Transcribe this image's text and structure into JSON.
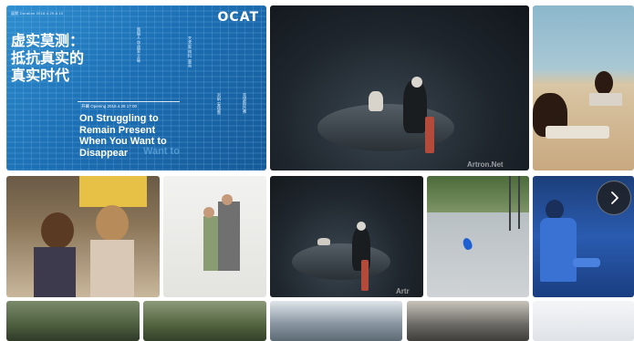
{
  "poster": {
    "logo": "OCAT",
    "dates_label": "展期 Duration  2018.4.29-6.10",
    "title_cn_line1": "虚实莫测：",
    "title_cn_line2": "抵抗真实的",
    "title_cn_line3": "真实时代",
    "opening_label": "开幕 Opening  2018.4.28  17:00",
    "title_en_line1": "On Struggling to",
    "title_en_line2": "Remain Present",
    "title_en_line3": "When You Want to",
    "title_en_line4": "Disappear",
    "ghost_text": "Want to",
    "vertical_text_1": "策展人 华迪爱 王咏",
    "vertical_text_2": "艺术家 林科 黄英",
    "vertical_text_3": "刘昕 安德鲁",
    "vertical_text_4": "克里斯托弗"
  },
  "watermarks": {
    "stage1": "Artron.Net",
    "stage2": "Artr"
  },
  "colors": {
    "poster_blue": "#1c6fb4",
    "next_button_bg": "#1e1e1e"
  },
  "controls": {
    "next_icon": "chevron-right-icon"
  }
}
